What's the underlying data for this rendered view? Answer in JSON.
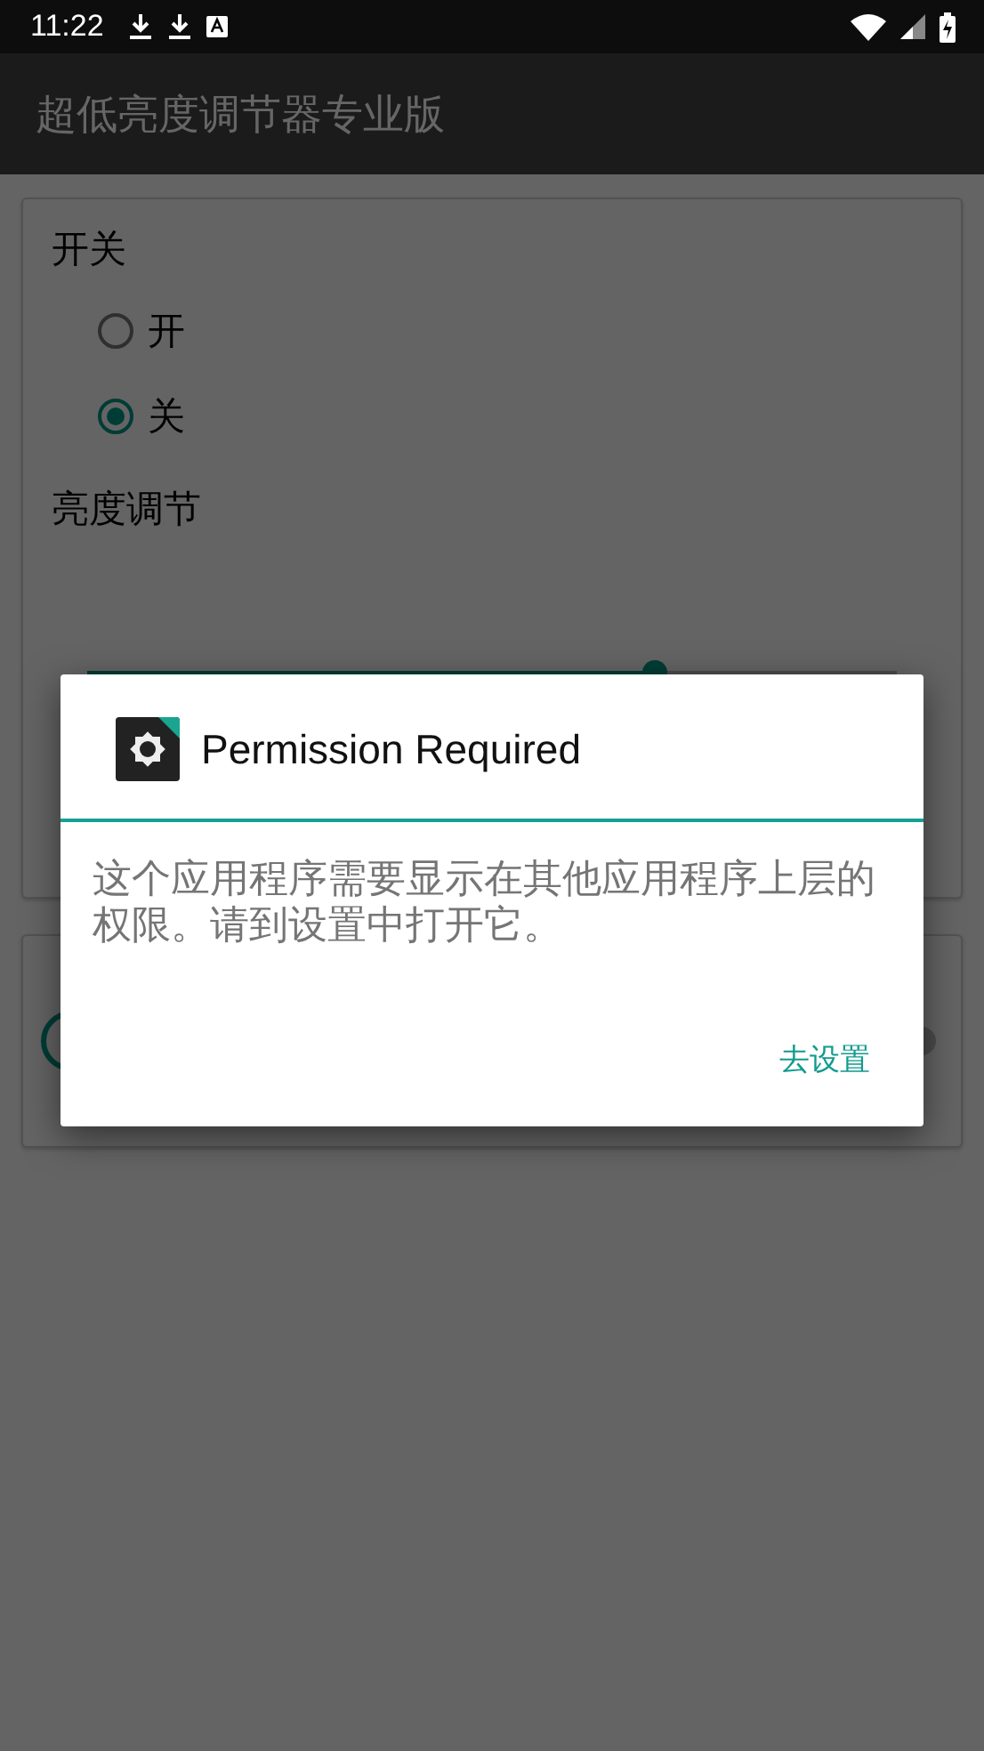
{
  "status_bar": {
    "time": "11:22"
  },
  "app_bar": {
    "title": "超低亮度调节器专业版"
  },
  "switch_section": {
    "label": "开关",
    "options": [
      {
        "label": "开",
        "selected": false
      },
      {
        "label": "关",
        "selected": true
      }
    ]
  },
  "brightness": {
    "label": "亮度调节",
    "level": 0.7
  },
  "dialog": {
    "title": "Permission Required",
    "message": "这个应用程序需要显示在其他应用程序上层的权限。请到设置中打开它。",
    "button": "去设置"
  }
}
